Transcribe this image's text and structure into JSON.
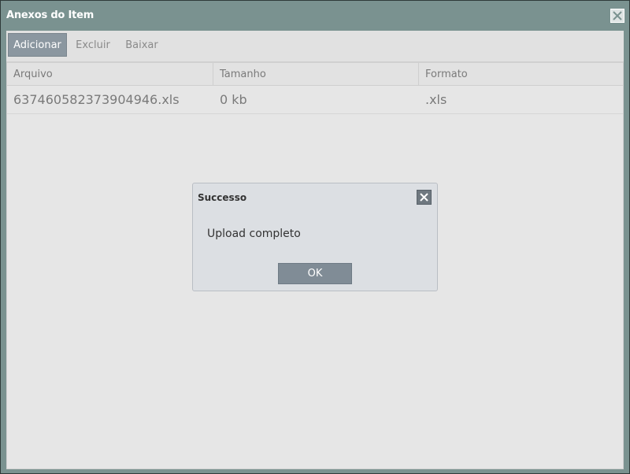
{
  "window": {
    "title": "Anexos do Item",
    "close_icon": "close-icon"
  },
  "toolbar": {
    "add_label": "Adicionar",
    "delete_label": "Excluir",
    "download_label": "Baixar"
  },
  "grid": {
    "columns": [
      "Arquivo",
      "Tamanho",
      "Formato"
    ],
    "rows": [
      {
        "file": "637460582373904946.xls",
        "size": "0 kb",
        "format": ".xls"
      }
    ]
  },
  "dialog": {
    "title": "Successo",
    "message": "Upload completo",
    "ok_label": "OK",
    "close_icon": "close-icon"
  },
  "colors": {
    "title_bar": "#7a9290",
    "toolbar_active": "#8b97a0",
    "dialog_bg": "#dcdfe3",
    "ok_button": "#808c96"
  }
}
